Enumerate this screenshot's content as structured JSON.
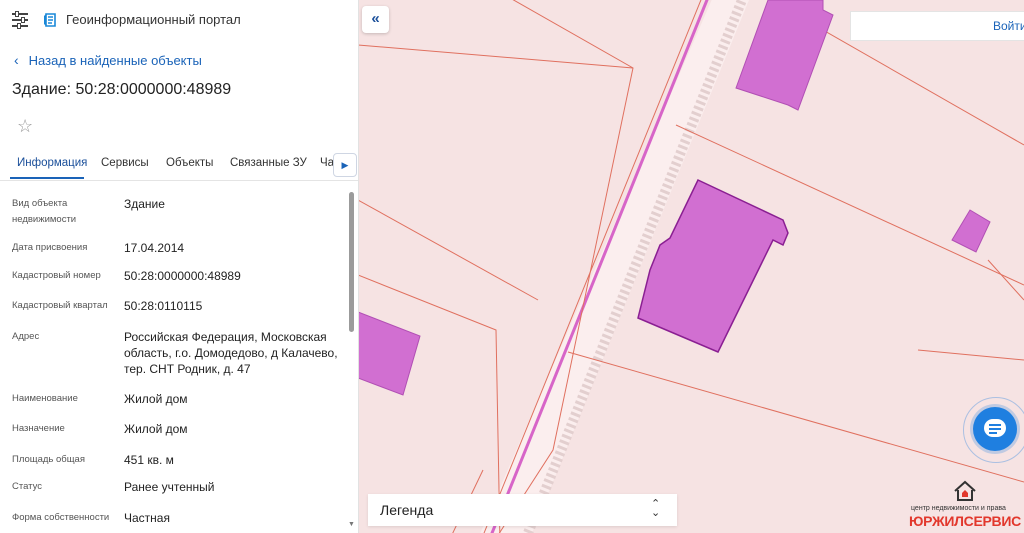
{
  "header": {
    "app_title": "Геоинформационный портал"
  },
  "back_link": "Назад в найденные объекты",
  "object_title": "Здание: 50:28:0000000:48989",
  "tabs": [
    {
      "label": "Информация"
    },
    {
      "label": "Сервисы"
    },
    {
      "label": "Объекты"
    },
    {
      "label": "Связанные ЗУ"
    },
    {
      "label": "Ча"
    }
  ],
  "info": [
    {
      "label": "Вид объекта недвижимости",
      "value": "Здание"
    },
    {
      "label": "Дата присвоения",
      "value": "17.04.2014"
    },
    {
      "label": "Кадастровый номер",
      "value": "50:28:0000000:48989"
    },
    {
      "label": "Кадастровый квартал",
      "value": "50:28:0110115"
    },
    {
      "label": "Адрес",
      "value": "Российская Федерация, Московская область, г.о. Домодедово, д Калачево, тер. СНТ Родник, д. 47"
    },
    {
      "label": "Наименование",
      "value": "Жилой дом"
    },
    {
      "label": "Назначение",
      "value": "Жилой дом"
    },
    {
      "label": "Площадь общая",
      "value": "451 кв. м"
    },
    {
      "label": "Статус",
      "value": "Ранее учтенный"
    },
    {
      "label": "Форма собственности",
      "value": "Частная"
    }
  ],
  "map": {
    "login_label": "Войти",
    "legend_label": "Легенда",
    "watermark_small": "центр недвижимости и права",
    "watermark_big": "ЮРЖИЛСЕРВИС"
  },
  "colors": {
    "accent": "#1a63b8",
    "map_bg": "#f6e3e3",
    "building_fill": "#d16fd1",
    "parcel_line": "#e0705f"
  }
}
